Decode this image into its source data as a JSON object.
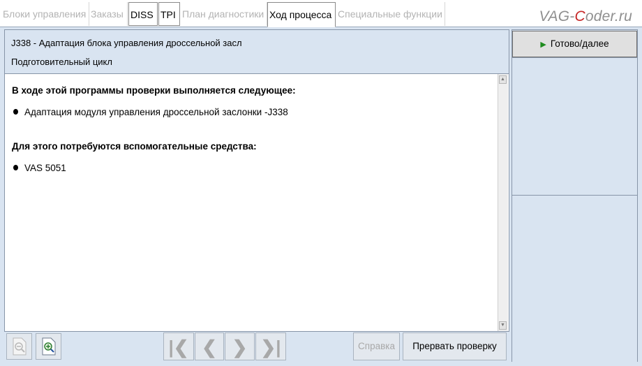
{
  "tabs": [
    {
      "label": "Блоки управления",
      "state": "disabled"
    },
    {
      "label": "Заказы",
      "state": "disabled"
    },
    {
      "label": "DISS",
      "state": "enabled"
    },
    {
      "label": "TPI",
      "state": "enabled"
    },
    {
      "label": "План диагностики",
      "state": "disabled"
    },
    {
      "label": "Ход процесса",
      "state": "active"
    },
    {
      "label": "Специальные функции",
      "state": "disabled"
    }
  ],
  "watermark": {
    "prefix": "VAG-",
    "highlight": "C",
    "suffix": "oder.ru"
  },
  "header": {
    "title": "J338 - Адаптация блока управления дроссельной засл",
    "subtitle": "Подготовительный цикл"
  },
  "content": {
    "heading1": "В ходе этой программы проверки выполняется следующее:",
    "item1": "Адаптация модуля управления дроссельной заслонки -J338",
    "heading2": "Для этого потребуются вспомогательные средства:",
    "item2": "VAS 5051"
  },
  "toolbar": {
    "help_label": "Справка",
    "abort_label": "Прервать проверку"
  },
  "right_panel": {
    "ready_label": "Готово/далее"
  },
  "colors": {
    "panel_bg": "#d9e4f1",
    "accent_green": "#1f8c1f",
    "brand_red": "#c62828"
  }
}
